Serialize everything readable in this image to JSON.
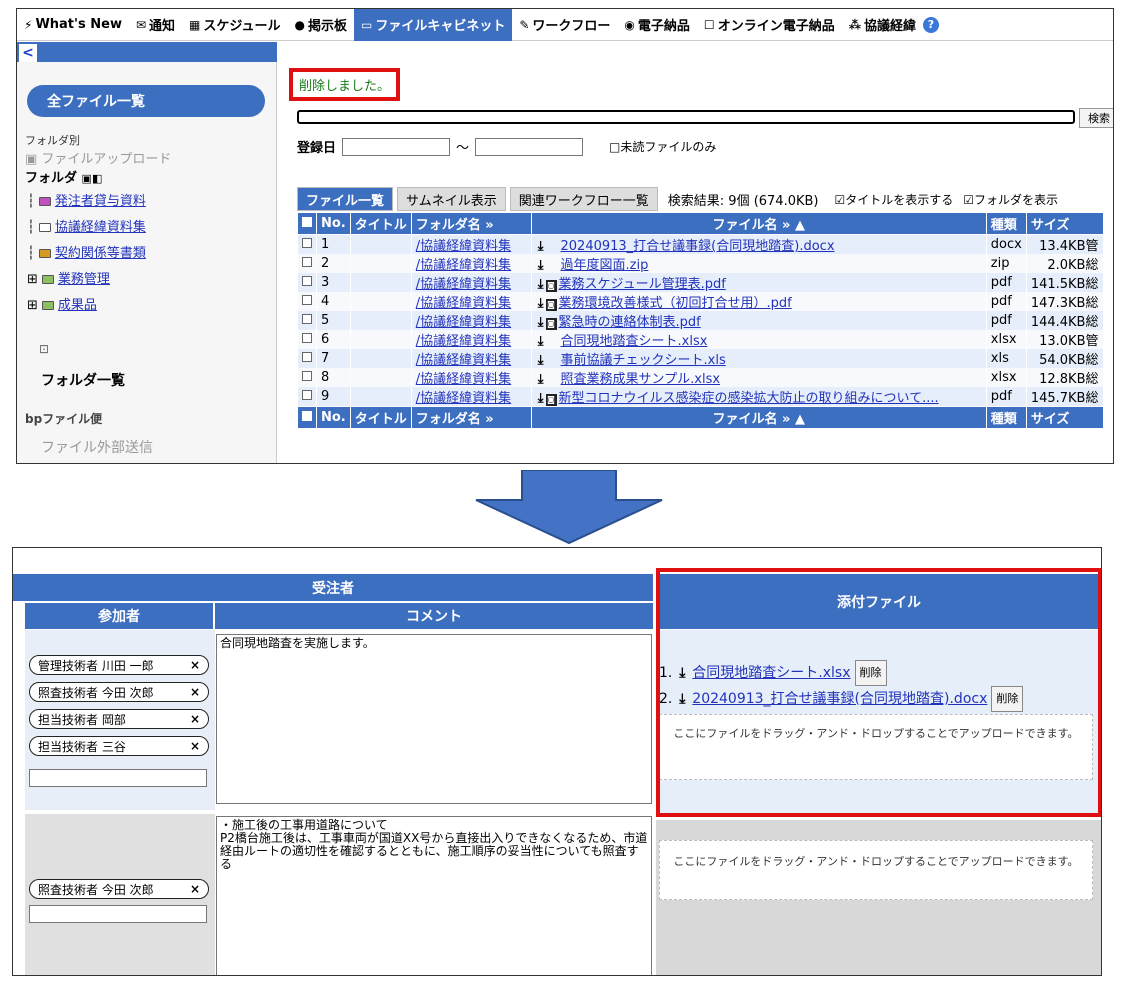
{
  "nav": {
    "items": [
      {
        "icon": "⚡",
        "label": "What's New"
      },
      {
        "icon": "✉",
        "label": "通知"
      },
      {
        "icon": "▦",
        "label": "スケジュール"
      },
      {
        "icon": "●",
        "label": "掲示板"
      },
      {
        "icon": "▭",
        "label": "ファイルキャビネット"
      },
      {
        "icon": "✎",
        "label": "ワークフロー"
      },
      {
        "icon": "◉",
        "label": "電子納品"
      },
      {
        "icon": "☐",
        "label": "オンライン電子納品"
      },
      {
        "icon": "⁂",
        "label": "協議経緯"
      }
    ],
    "help": "?"
  },
  "sidebar": {
    "collapse": "<",
    "all_files": "全ファイル一覧",
    "by_folder": "フォルダ別",
    "upload": "ファイルアップロード",
    "folder_label": "フォルダ",
    "folder_ctrl": "▣◧",
    "tree": [
      {
        "label": "発注者貸与資料",
        "color": "#c050c0"
      },
      {
        "label": "協議経緯資料集",
        "color": "#ffffff"
      },
      {
        "label": "契約関係等書類",
        "color": "#d59a20"
      },
      {
        "label": "業務管理",
        "color": "#8cc060"
      },
      {
        "label": "成果品",
        "color": "#8cc060"
      }
    ],
    "folder_list": "フォルダ一覧",
    "bp_label": "bpファイル便",
    "external": "ファイル外部送信"
  },
  "main": {
    "message": "削除しました。",
    "search_button": "検索",
    "date_label": "登録日",
    "tilde": "～",
    "unread_only": "□未読ファイルのみ",
    "tabs": [
      "ファイル一覧",
      "サムネイル表示",
      "関連ワークフロー一覧"
    ],
    "result": "検索結果: 9個 (674.0KB)",
    "show_title": "☑タイトルを表示する",
    "show_folder": "☑フォルダを表示",
    "columns": [
      "No.",
      "タイトル",
      "フォルダ名 »",
      "ファイル名 » ▲",
      "種類",
      "サイズ"
    ],
    "rows": [
      {
        "no": "1",
        "folder": "/協議経緯資料集",
        "preview": false,
        "file": "20240913_打合せ議事録(合同現地踏査).docx",
        "type": "docx",
        "size": "13.4KB",
        "extra": "管"
      },
      {
        "no": "2",
        "folder": "/協議経緯資料集",
        "preview": false,
        "file": "過年度図面.zip",
        "type": "zip",
        "size": "2.0KB",
        "extra": "総"
      },
      {
        "no": "3",
        "folder": "/協議経緯資料集",
        "preview": true,
        "file": "業務スケジュール管理表.pdf",
        "type": "pdf",
        "size": "141.5KB",
        "extra": "総"
      },
      {
        "no": "4",
        "folder": "/協議経緯資料集",
        "preview": true,
        "file": "業務環境改善様式（初回打合せ用）.pdf",
        "type": "pdf",
        "size": "147.3KB",
        "extra": "総"
      },
      {
        "no": "5",
        "folder": "/協議経緯資料集",
        "preview": true,
        "file": "緊急時の連絡体制表.pdf",
        "type": "pdf",
        "size": "144.4KB",
        "extra": "総"
      },
      {
        "no": "6",
        "folder": "/協議経緯資料集",
        "preview": false,
        "file": "合同現地踏査シート.xlsx",
        "type": "xlsx",
        "size": "13.0KB",
        "extra": "管"
      },
      {
        "no": "7",
        "folder": "/協議経緯資料集",
        "preview": false,
        "file": "事前協議チェックシート.xls",
        "type": "xls",
        "size": "54.0KB",
        "extra": "総"
      },
      {
        "no": "8",
        "folder": "/協議経緯資料集",
        "preview": false,
        "file": "照査業務成果サンプル.xlsx",
        "type": "xlsx",
        "size": "12.8KB",
        "extra": "総"
      },
      {
        "no": "9",
        "folder": "/協議経緯資料集",
        "preview": true,
        "file": "新型コロナウイルス感染症の感染拡大防止の取り組みについて....",
        "type": "pdf",
        "size": "145.7KB",
        "extra": "総"
      }
    ]
  },
  "bottom": {
    "contractor": "受注者",
    "participants_header": "参加者",
    "comment_header": "コメント",
    "attach_header": "添付ファイル",
    "row1": {
      "tags": [
        "管理技術者 川田 一郎",
        "照査技術者 今田 次郎",
        "担当技術者 岡部",
        "担当技術者 三谷"
      ],
      "comment": "合同現地踏査を実施します。",
      "files": [
        {
          "num": "1.",
          "name": "合同現地踏査シート.xlsx",
          "delete": "削除"
        },
        {
          "num": "2.",
          "name": "20240913_打合せ議事録(合同現地踏査).docx",
          "delete": "削除"
        }
      ],
      "drop": "ここにファイルをドラッグ・アンド・ドロップすることでアップロードできます。"
    },
    "row2": {
      "tags": [
        "照査技術者 今田 次郎"
      ],
      "comment": "・施工後の工事用道路について\nP2橋台施工後は、工事車両が国道XX号から直接出入りできなくなるため、市道経由ルートの適切性を確認するとともに、施工順序の妥当性についても照査する",
      "drop": "ここにファイルをドラッグ・アンド・ドロップすることでアップロードできます。"
    },
    "tag_close": "×"
  }
}
